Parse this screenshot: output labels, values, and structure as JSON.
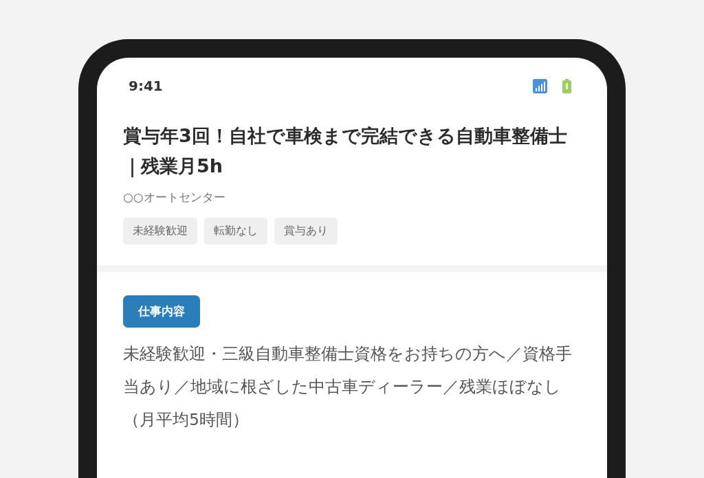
{
  "status_bar": {
    "time": "9:41"
  },
  "job": {
    "title": "賞与年3回！自社で車検まで完結できる自動車整備士｜残業月5h",
    "company": "○○オートセンター",
    "tags": [
      "未経験歓迎",
      "転勤なし",
      "賞与あり"
    ]
  },
  "section": {
    "heading": "仕事内容",
    "body": "未経験歓迎・三級自動車整備士資格をお持ちの方へ／資格手当あり／地域に根ざした中古車ディーラー／残業ほぼなし（月平均5時間）"
  }
}
